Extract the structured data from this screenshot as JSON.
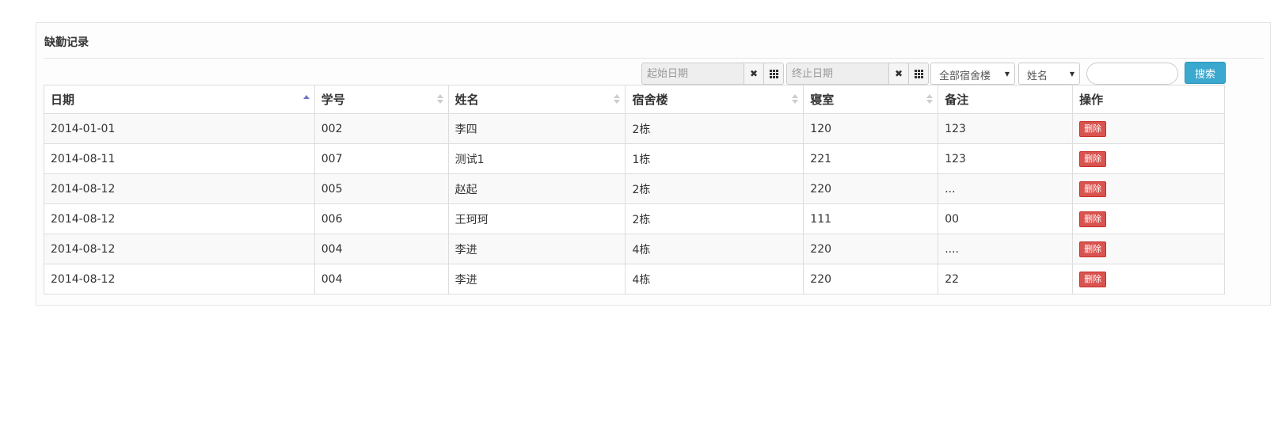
{
  "panel": {
    "title": "缺勤记录"
  },
  "filters": {
    "start_date_placeholder": "起始日期",
    "end_date_placeholder": "终止日期",
    "clear_glyph": "✖",
    "building_select": "全部宿舍楼",
    "field_select": "姓名",
    "search_value": "",
    "search_button": "搜索"
  },
  "table": {
    "columns": [
      {
        "label": "日期",
        "sort": "asc"
      },
      {
        "label": "学号",
        "sort": "none"
      },
      {
        "label": "姓名",
        "sort": "none"
      },
      {
        "label": "宿舍楼",
        "sort": "none"
      },
      {
        "label": "寝室",
        "sort": "none"
      },
      {
        "label": "备注",
        "sort": ""
      },
      {
        "label": "操作",
        "sort": ""
      }
    ],
    "rows": [
      {
        "date": "2014-01-01",
        "student_id": "002",
        "name": "李四",
        "building": "2栋",
        "room": "120",
        "note": "123",
        "action": "删除"
      },
      {
        "date": "2014-08-11",
        "student_id": "007",
        "name": "测试1",
        "building": "1栋",
        "room": "221",
        "note": "123",
        "action": "删除"
      },
      {
        "date": "2014-08-12",
        "student_id": "005",
        "name": "赵起",
        "building": "2栋",
        "room": "220",
        "note": "...",
        "action": "删除"
      },
      {
        "date": "2014-08-12",
        "student_id": "006",
        "name": "王珂珂",
        "building": "2栋",
        "room": "111",
        "note": "00",
        "action": "删除"
      },
      {
        "date": "2014-08-12",
        "student_id": "004",
        "name": "李进",
        "building": "4栋",
        "room": "220",
        "note": "....",
        "action": "删除"
      },
      {
        "date": "2014-08-12",
        "student_id": "004",
        "name": "李进",
        "building": "4栋",
        "room": "220",
        "note": "22",
        "action": "删除"
      }
    ]
  },
  "colors": {
    "search_button": "#3aa8cf",
    "delete_button": "#d9534f",
    "sort_active": "#6c78c4"
  }
}
